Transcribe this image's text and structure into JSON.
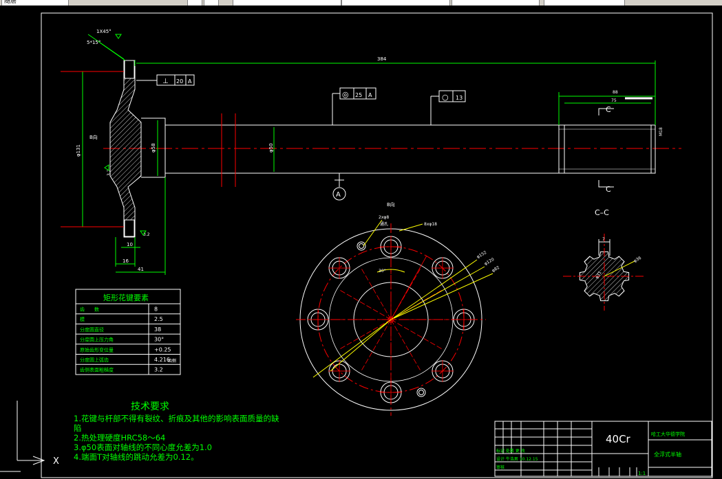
{
  "toolbar": {
    "cells": [
      "随层",
      "",
      "",
      "",
      "",
      "",
      "",
      ""
    ]
  },
  "drawing": {
    "dimensions": {
      "chamfer": "1X45°",
      "seat_angle": "5*15°",
      "overall_length": "384",
      "spline_length_top": "88",
      "spline_length_inner": "75",
      "flange_dia": "φ131",
      "hub_dia": "φ58",
      "shaft_dia": "φ50",
      "thickness_10": "10",
      "thickness_16": "16",
      "width_41": "41",
      "view_b": "B向",
      "roughness_1": "3.2",
      "roughness_2": "3.2",
      "thread": "M18",
      "spline_dia": "φ36"
    },
    "tolerances": {
      "perpendicularity": {
        "symbol": "⊥",
        "value": "20",
        "datum": "A"
      },
      "concentricity": {
        "symbol": "◎",
        "value": "25",
        "datum": "A"
      },
      "cylindricity": {
        "symbol": "○",
        "value": "13"
      }
    },
    "datum_label": "A",
    "section_labels": {
      "c_top": "C",
      "c_bottom": "C",
      "cc_title": "C–C"
    },
    "flange_view": {
      "title": "B向",
      "hole_note_small": "2xφ8",
      "hole_note_small_sub": "通孔",
      "hole_note_large": "8xφ18",
      "angle": "30°",
      "d1": "φ152",
      "d2": "φ120",
      "d3": "φ82"
    },
    "cc_view": {
      "width": "7",
      "dia_outer": "φ36",
      "dia_inner": "φ31"
    }
  },
  "spline_table": {
    "title": "矩形花键要素",
    "rows": [
      {
        "label": "齿　　数",
        "value": "8"
      },
      {
        "label": "模",
        "value": "2.5"
      },
      {
        "label": "分度圆直径",
        "value": "38"
      },
      {
        "label": "分度圆上压力角",
        "value": "30°"
      },
      {
        "label": "原始齿形变位量",
        "value": "+0.25"
      },
      {
        "label": "分度圆上弧齿",
        "value": "4.216"
      },
      {
        "label": "齿侧表面粗糙度",
        "value": "3.2"
      }
    ],
    "extra_note": "齿侧"
  },
  "tech_requirements": {
    "title": "技术要求",
    "lines": [
      "1.花键与杆部不得有裂纹、折痕及其他的影响表面质量的缺",
      "陷",
      "2.热处理硬度HRC58～64",
      "3.φ50表面对轴线的不同心度允差为1.0",
      "4.端面T对轴线的跳动允差为0.12。"
    ]
  },
  "title_block": {
    "material": "40Cr",
    "school": "哈工大华德学院",
    "part_name": "全浮式半轴",
    "scale": "1:1",
    "row1": "标记 处数 更 改",
    "row2": "设计 牛浩男 10.12.15",
    "row3": "审核"
  },
  "ucs": {
    "x_label": "X"
  },
  "colors": {
    "bg": "#000000",
    "outline": "#ffffff",
    "dimension": "#00ff00",
    "center": "#ff0000",
    "construction": "#ffff00"
  }
}
